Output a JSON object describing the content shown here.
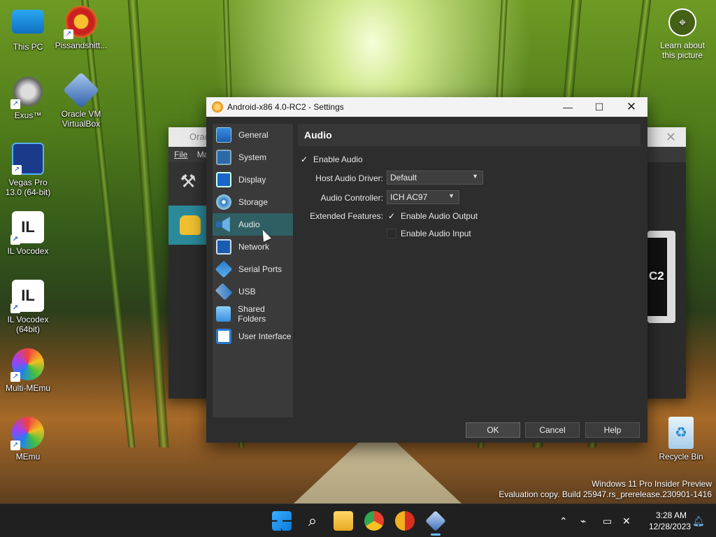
{
  "desktop": {
    "icons": [
      {
        "label": "This PC"
      },
      {
        "label": "Pissandshitt..."
      },
      {
        "label": "Exus™"
      },
      {
        "label": "Oracle VM VirtualBox"
      },
      {
        "label": "Vegas Pro 13.0 (64-bit)"
      },
      {
        "label": "IL Vocodex"
      },
      {
        "label": "IL Vocodex (64bit)"
      },
      {
        "label": "Multi-MEmu"
      },
      {
        "label": "MEmu"
      },
      {
        "label": "Recycle Bin"
      }
    ],
    "learn_about": "Learn about this picture",
    "watermark_line1": "Windows 11 Pro Insider Preview",
    "watermark_line2": "Evaluation copy. Build 25947.rs_prerelease.230901-1416"
  },
  "background_window": {
    "title": "Orac",
    "menu_file": "File",
    "menu_machine": "Ma",
    "preview_text": "C2"
  },
  "dialog": {
    "title": "Android-x86 4.0-RC2 - Settings",
    "sidebar": [
      {
        "label": "General",
        "icon": "general-icon"
      },
      {
        "label": "System",
        "icon": "system-icon"
      },
      {
        "label": "Display",
        "icon": "display-icon"
      },
      {
        "label": "Storage",
        "icon": "storage-icon"
      },
      {
        "label": "Audio",
        "icon": "audio-icon",
        "active": true
      },
      {
        "label": "Network",
        "icon": "network-icon"
      },
      {
        "label": "Serial Ports",
        "icon": "serial-ports-icon"
      },
      {
        "label": "USB",
        "icon": "usb-icon"
      },
      {
        "label": "Shared Folders",
        "icon": "shared-folders-icon"
      },
      {
        "label": "User Interface",
        "icon": "user-interface-icon"
      }
    ],
    "section_title": "Audio",
    "enable_audio": {
      "label": "Enable Audio",
      "checked": true
    },
    "host_audio_driver": {
      "label": "Host Audio Driver:",
      "value": "Default"
    },
    "audio_controller": {
      "label": "Audio Controller:",
      "value": "ICH AC97"
    },
    "extended_features_label": "Extended Features:",
    "enable_audio_output": {
      "label": "Enable Audio Output",
      "checked": true
    },
    "enable_audio_input": {
      "label": "Enable Audio Input",
      "checked": false
    },
    "buttons": {
      "ok": "OK",
      "cancel": "Cancel",
      "help": "Help"
    },
    "check_glyph": "✓"
  },
  "taskbar": {
    "time": "3:28 AM",
    "date": "12/28/2023"
  },
  "colors": {
    "dialog_bg": "#2d2d2d",
    "sidebar_bg": "#3a3a3a",
    "active_item": "#2f5f63",
    "taskbar": "#202020"
  }
}
